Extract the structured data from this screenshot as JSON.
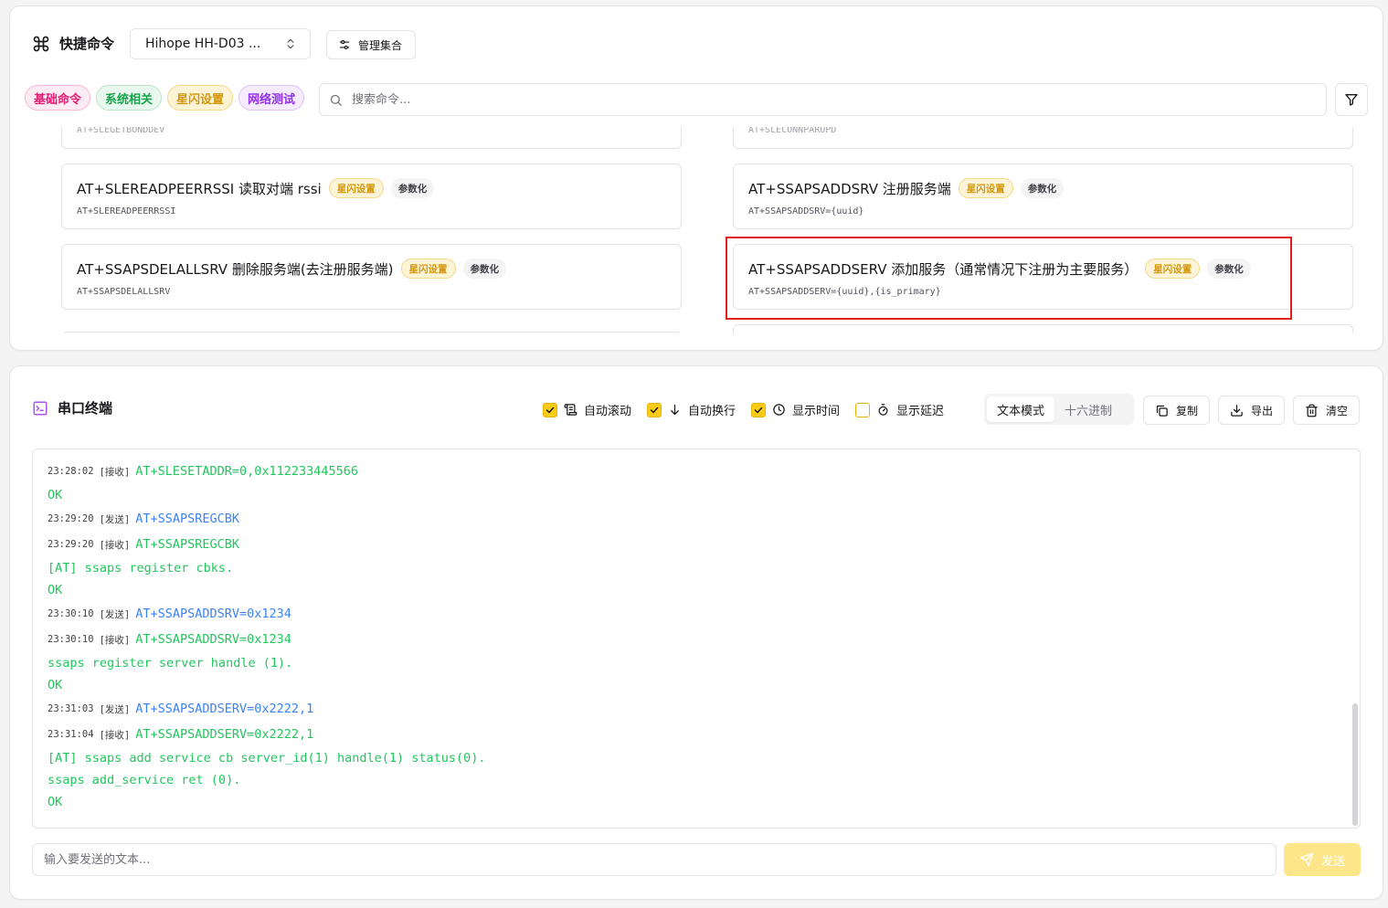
{
  "quick_commands": {
    "title": "快捷命令",
    "device": "Hihope HH-D03 ...",
    "manage_label": "管理集合",
    "tags": [
      {
        "label": "基础命令",
        "color": "red"
      },
      {
        "label": "系统相关",
        "color": "green"
      },
      {
        "label": "星闪设置",
        "color": "yellow"
      },
      {
        "label": "网络测试",
        "color": "purple"
      }
    ],
    "search_placeholder": "搜索命令...",
    "cards": [
      {
        "title": "AT+SLEREADPEERRSSI 读取对端 rssi",
        "tag": "星闪设置",
        "param": "参数化",
        "command": "AT+SLEREADPEERRSSI"
      },
      {
        "title": "AT+SSAPSADDSRV 注册服务端",
        "tag": "星闪设置",
        "param": "参数化",
        "command": "AT+SSAPSADDSRV={uuid}"
      },
      {
        "title": "AT+SSAPSDELALLSRV 删除服务端(去注册服务端)",
        "tag": "星闪设置",
        "param": "参数化",
        "command": "AT+SSAPSDELALLSRV"
      },
      {
        "title": "AT+SSAPSADDSERV 添加服务（通常情况下注册为主要服务）",
        "tag": "星闪设置",
        "param": "参数化",
        "command": "AT+SSAPSADDSERV={uuid},{is_primary}"
      }
    ],
    "partial_top": {
      "left": "AT+SLEGETBONDDEV",
      "right": "AT+SLECONNPARUPD"
    }
  },
  "terminal": {
    "title": "串口终端",
    "controls": [
      {
        "label": "自动滚动",
        "checked": true,
        "icon": "scroll-text-icon"
      },
      {
        "label": "自动换行",
        "checked": true,
        "icon": "arrow-down-icon"
      },
      {
        "label": "显示时间",
        "checked": true,
        "icon": "clock-icon"
      },
      {
        "label": "显示延迟",
        "checked": false,
        "icon": "timer-icon"
      }
    ],
    "modes": {
      "text": "文本模式",
      "hex": "十六进制"
    },
    "copy_label": "复制",
    "export_label": "导出",
    "clear_label": "清空",
    "lines": [
      {
        "time": "23:28:02",
        "dir": "[接收]",
        "kind": "recv",
        "text": "AT+SLESETADDR=0,0x112233445566"
      },
      {
        "kind": "recv-cont",
        "text": "OK"
      },
      {
        "time": "23:29:20",
        "dir": "[发送]",
        "kind": "sent",
        "text": "AT+SSAPSREGCBK"
      },
      {
        "time": "23:29:20",
        "dir": "[接收]",
        "kind": "recv",
        "text": "AT+SSAPSREGCBK"
      },
      {
        "kind": "recv-cont",
        "text": "[AT] ssaps register cbks."
      },
      {
        "kind": "recv-cont",
        "text": "OK"
      },
      {
        "time": "23:30:10",
        "dir": "[发送]",
        "kind": "sent",
        "text": "AT+SSAPSADDSRV=0x1234"
      },
      {
        "time": "23:30:10",
        "dir": "[接收]",
        "kind": "recv",
        "text": "AT+SSAPSADDSRV=0x1234"
      },
      {
        "kind": "recv-cont",
        "text": "ssaps register server handle (1)."
      },
      {
        "kind": "recv-cont",
        "text": "OK"
      },
      {
        "time": "23:31:03",
        "dir": "[发送]",
        "kind": "sent",
        "text": "AT+SSAPSADDSERV=0x2222,1"
      },
      {
        "time": "23:31:04",
        "dir": "[接收]",
        "kind": "recv",
        "text": "AT+SSAPSADDSERV=0x2222,1"
      },
      {
        "kind": "recv-cont",
        "text": "[AT] ssaps add service cb server_id(1) handle(1) status(0)."
      },
      {
        "kind": "recv-cont",
        "text": "ssaps add_service ret (0)."
      },
      {
        "kind": "recv-cont",
        "text": "OK"
      }
    ],
    "input_placeholder": "输入要发送的文本...",
    "send_label": "发送"
  }
}
